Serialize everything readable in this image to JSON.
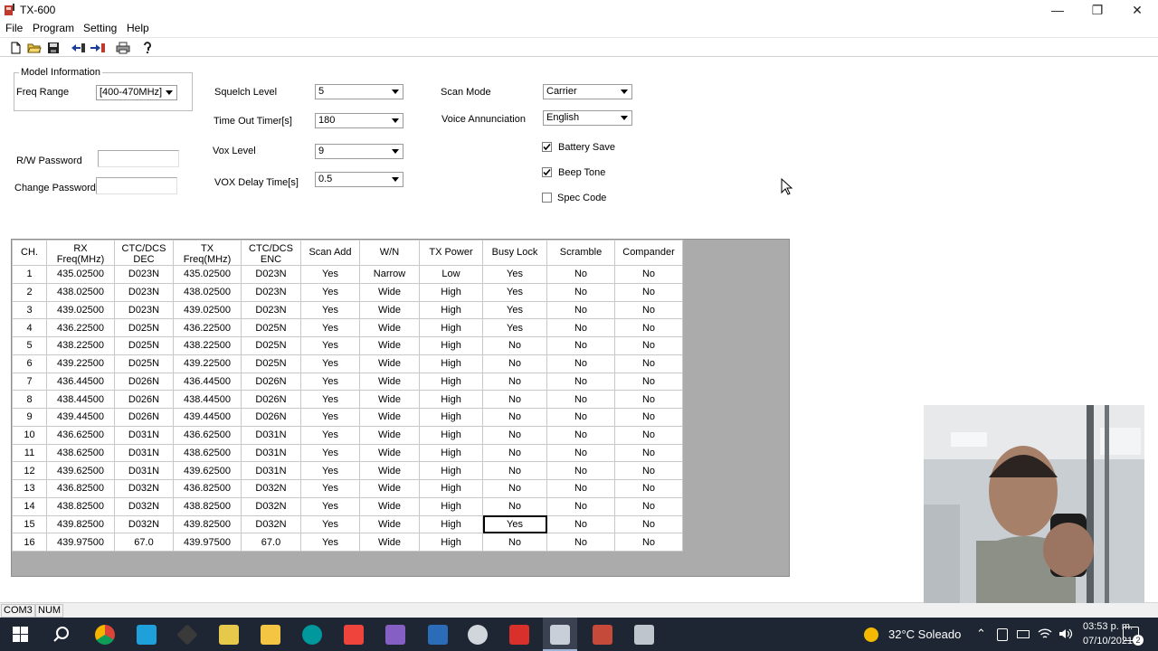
{
  "window": {
    "title": "TX-600"
  },
  "menu": [
    "File",
    "Program",
    "Setting",
    "Help"
  ],
  "toolbar_icons": [
    "new-file-icon",
    "open-folder-icon",
    "save-icon",
    "read-from-radio-icon",
    "write-to-radio-icon",
    "print-icon",
    "help-icon"
  ],
  "model_info": {
    "legend": "Model Information",
    "freq_range_label": "Freq Range",
    "freq_range_value": "[400-470MHz]"
  },
  "passwords": {
    "rw_label": "R/W Password",
    "rw_value": "",
    "change_label": "Change Password",
    "change_value": ""
  },
  "settings_mid": {
    "squelch_label": "Squelch Level",
    "squelch_value": "5",
    "timeout_label": "Time Out Timer[s]",
    "timeout_value": "180",
    "vox_label": "Vox Level",
    "vox_value": "9",
    "voxdelay_label": "VOX Delay Time[s]",
    "voxdelay_value": "0.5"
  },
  "settings_right": {
    "scanmode_label": "Scan Mode",
    "scanmode_value": "Carrier",
    "voice_label": "Voice Annunciation",
    "voice_value": "English",
    "battery_label": "Battery Save",
    "battery_checked": true,
    "beep_label": "Beep Tone",
    "beep_checked": true,
    "spec_label": "Spec Code",
    "spec_checked": false
  },
  "grid": {
    "headers": [
      [
        "CH."
      ],
      [
        "RX",
        "Freq(MHz)"
      ],
      [
        "CTC/DCS",
        "DEC"
      ],
      [
        "TX",
        "Freq(MHz)"
      ],
      [
        "CTC/DCS",
        "ENC"
      ],
      [
        "Scan Add"
      ],
      [
        "W/N"
      ],
      [
        "TX Power"
      ],
      [
        "Busy Lock"
      ],
      [
        "Scramble"
      ],
      [
        "Compander"
      ]
    ],
    "rows": [
      [
        "1",
        "435.02500",
        "D023N",
        "435.02500",
        "D023N",
        "Yes",
        "Narrow",
        "Low",
        "Yes",
        "No",
        "No"
      ],
      [
        "2",
        "438.02500",
        "D023N",
        "438.02500",
        "D023N",
        "Yes",
        "Wide",
        "High",
        "Yes",
        "No",
        "No"
      ],
      [
        "3",
        "439.02500",
        "D023N",
        "439.02500",
        "D023N",
        "Yes",
        "Wide",
        "High",
        "Yes",
        "No",
        "No"
      ],
      [
        "4",
        "436.22500",
        "D025N",
        "436.22500",
        "D025N",
        "Yes",
        "Wide",
        "High",
        "Yes",
        "No",
        "No"
      ],
      [
        "5",
        "438.22500",
        "D025N",
        "438.22500",
        "D025N",
        "Yes",
        "Wide",
        "High",
        "No",
        "No",
        "No"
      ],
      [
        "6",
        "439.22500",
        "D025N",
        "439.22500",
        "D025N",
        "Yes",
        "Wide",
        "High",
        "No",
        "No",
        "No"
      ],
      [
        "7",
        "436.44500",
        "D026N",
        "436.44500",
        "D026N",
        "Yes",
        "Wide",
        "High",
        "No",
        "No",
        "No"
      ],
      [
        "8",
        "438.44500",
        "D026N",
        "438.44500",
        "D026N",
        "Yes",
        "Wide",
        "High",
        "No",
        "No",
        "No"
      ],
      [
        "9",
        "439.44500",
        "D026N",
        "439.44500",
        "D026N",
        "Yes",
        "Wide",
        "High",
        "No",
        "No",
        "No"
      ],
      [
        "10",
        "436.62500",
        "D031N",
        "436.62500",
        "D031N",
        "Yes",
        "Wide",
        "High",
        "No",
        "No",
        "No"
      ],
      [
        "11",
        "438.62500",
        "D031N",
        "438.62500",
        "D031N",
        "Yes",
        "Wide",
        "High",
        "No",
        "No",
        "No"
      ],
      [
        "12",
        "439.62500",
        "D031N",
        "439.62500",
        "D031N",
        "Yes",
        "Wide",
        "High",
        "No",
        "No",
        "No"
      ],
      [
        "13",
        "436.82500",
        "D032N",
        "436.82500",
        "D032N",
        "Yes",
        "Wide",
        "High",
        "No",
        "No",
        "No"
      ],
      [
        "14",
        "438.82500",
        "D032N",
        "438.82500",
        "D032N",
        "Yes",
        "Wide",
        "High",
        "No",
        "No",
        "No"
      ],
      [
        "15",
        "439.82500",
        "D032N",
        "439.82500",
        "D032N",
        "Yes",
        "Wide",
        "High",
        "Yes",
        "No",
        "No"
      ],
      [
        "16",
        "439.97500",
        "67.0",
        "439.97500",
        "67.0",
        "Yes",
        "Wide",
        "High",
        "No",
        "No",
        "No"
      ]
    ]
  },
  "status": {
    "port": "COM3",
    "numlock": "NUM"
  },
  "taskbar": {
    "apps": [
      "chrome-icon",
      "camtasia-icon",
      "inkscape-icon",
      "notepad-icon",
      "file-explorer-icon",
      "arduino-icon",
      "anydesk-icon",
      "visual-studio-icon",
      "settings-app-icon",
      "screen-capture-icon",
      "pdf-reader-icon",
      "tx600-app-icon",
      "radio-programmer-icon",
      "calculator-icon"
    ],
    "weather": "32°C  Soleado",
    "time": "03:53 p. m.",
    "date": "07/10/2021",
    "notifications": "2"
  },
  "colors": {
    "taskbar_bg": "#1f2633",
    "grid_bg": "#ababab",
    "statusbar_bg": "#f0f0f0"
  }
}
